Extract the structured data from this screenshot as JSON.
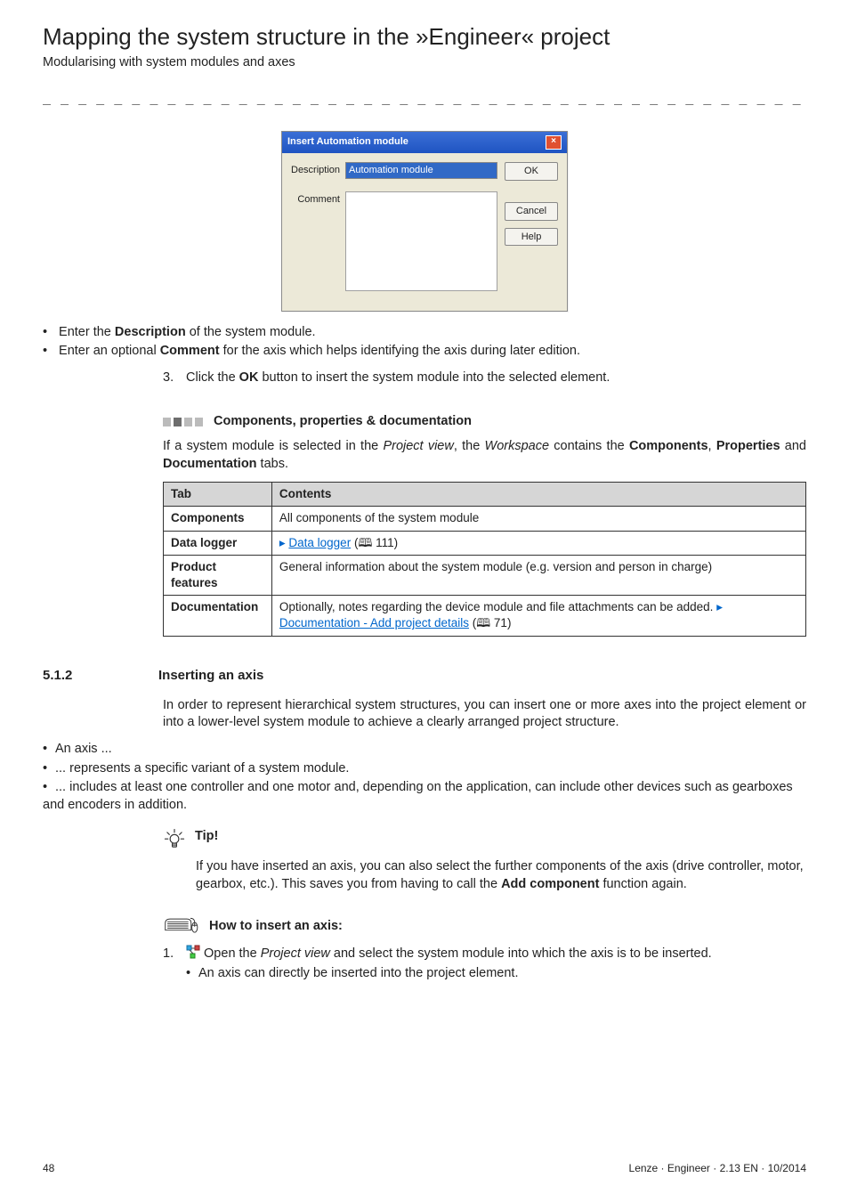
{
  "header": {
    "title": "Mapping the system structure in the »Engineer« project",
    "subtitle": "Modularising with system modules  and axes"
  },
  "dashes": "_ _ _ _ _ _ _ _ _ _ _ _ _ _ _ _ _ _ _ _ _ _ _ _ _ _ _ _ _ _ _ _ _ _ _ _ _ _ _ _ _ _ _ _ _ _ _ _ _ _ _ _ _ _ _ _ _ _ _ _ _ _ _ _",
  "dialog": {
    "title": "Insert Automation module",
    "description_label": "Description",
    "description_value": "Automation module",
    "comment_label": "Comment",
    "ok": "OK",
    "cancel": "Cancel",
    "help": "Help"
  },
  "after_dialog": {
    "b1": "Enter the Description of the system module.",
    "b1_pre": "Enter the ",
    "b1_bold": "Description",
    "b1_post": " of the system module.",
    "b2_pre": "Enter an optional ",
    "b2_bold": "Comment",
    "b2_post": " for the axis which helps identifying the axis during later edition.",
    "step3_n": "3.",
    "step3_pre": "Click the ",
    "step3_bold": "OK",
    "step3_post": " button to insert the system module into the selected element."
  },
  "components_section": {
    "label": "Components, properties & documentation",
    "para_pre": "If a system module is selected in the ",
    "para_i1": "Project view",
    "para_mid1": ", the ",
    "para_i2": "Workspace",
    "para_mid2": " contains the ",
    "para_b1": "Components",
    "para_mid3": ", ",
    "para_b2": "Properties",
    "para_mid4": " and ",
    "para_b3": "Documentation",
    "para_post": " tabs."
  },
  "table": {
    "h0": "Tab",
    "h1": "Contents",
    "rows": [
      {
        "c0": "Components",
        "c1": "All components of the system module"
      },
      {
        "c0": "Data logger",
        "link_pre": "Data logger",
        "link_ref": " 111)"
      },
      {
        "c0": "Product features",
        "c1": "General information about the system module (e.g. version and person in charge)"
      },
      {
        "c0": "Documentation",
        "c1_pre": "Optionally, notes regarding the device module and file attachments can be added.  ",
        "link": "Documentation - Add project details",
        "link_ref": " 71)"
      }
    ]
  },
  "sec512": {
    "num": "5.1.2",
    "title": "Inserting an axis",
    "lead": "In order to represent hierarchical system structures, you can insert one or more axes into the project element or into a lower-level system module to achieve a clearly arranged project structure.",
    "b1": "An axis ...",
    "b2": "... represents a specific variant of a system module.",
    "b3": "... includes at least one controller and one motor and, depending on the application, can include other devices such as gearboxes and encoders in addition."
  },
  "tip": {
    "label": "Tip!",
    "text_pre": "If you have inserted an axis, you can also select the further components of the axis (drive controller, motor, gearbox, etc.). This saves you from having to call the ",
    "text_bold": "Add component",
    "text_post": " function again."
  },
  "howto": {
    "label": "How to insert an axis:",
    "step1_n": "1.",
    "step1_pre": "Open the ",
    "step1_i": "Project view",
    "step1_post": " and select the system module into which the axis is to be inserted.",
    "step1_sub": "An axis can directly be inserted into the project element."
  },
  "footer": {
    "page": "48",
    "right": "Lenze · Engineer · 2.13 EN · 10/2014"
  }
}
